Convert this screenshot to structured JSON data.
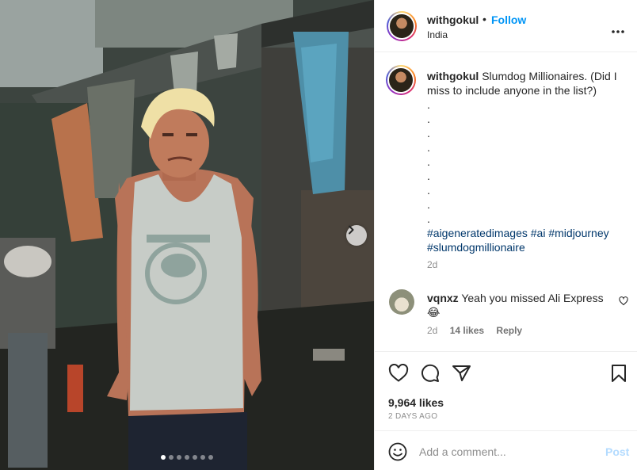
{
  "post": {
    "username": "withgokul",
    "separator": "•",
    "follow_label": "Follow",
    "location": "India",
    "caption_username": "withgokul",
    "caption_text": "Slumdog Millionaires. (Did I miss to include anyone in the list?)",
    "caption_dots": [
      ".",
      ".",
      ".",
      ".",
      ".",
      ".",
      ".",
      ".",
      "."
    ],
    "hashtags": [
      "#aigeneratedimages",
      "#ai",
      "#midjourney",
      "#slumdogmillionaire"
    ],
    "caption_time": "2d",
    "likes": "9,964 likes",
    "posted": "2 DAYS AGO"
  },
  "comment": {
    "username": "vqnxz",
    "text": "Yeah you missed Ali Express",
    "emoji": "😂",
    "time": "2d",
    "likes": "14 likes",
    "reply_label": "Reply"
  },
  "comment_box": {
    "placeholder": "Add a comment...",
    "post_label": "Post"
  },
  "carousel": {
    "slide_count": 7,
    "current_slide": 1
  },
  "icons": {
    "more": "more-options-icon",
    "like": "heart-icon",
    "comment": "comment-icon",
    "share": "share-icon",
    "save": "bookmark-icon",
    "emoji": "emoji-icon",
    "next": "chevron-right-icon"
  },
  "colors": {
    "follow": "#0095f6",
    "hashtag": "#00376b",
    "post_disabled": "#b3dbff"
  }
}
